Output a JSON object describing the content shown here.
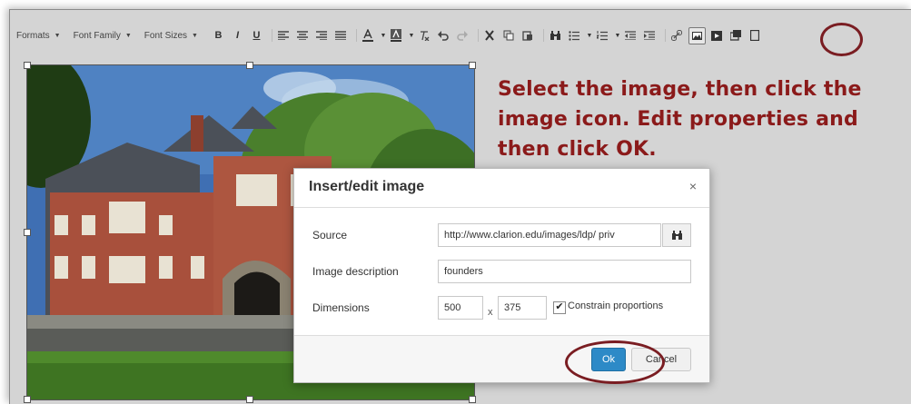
{
  "toolbar": {
    "formats_label": "Formats",
    "font_family_label": "Font Family",
    "font_sizes_label": "Font Sizes",
    "bold_label": "B",
    "italic_label": "I",
    "underline_label": "U"
  },
  "instruction": {
    "text": "Select the image, then click the image icon. Edit properties and then click OK."
  },
  "dialog": {
    "title": "Insert/edit image",
    "close_label": "×",
    "source_label": "Source",
    "source_value": "http://www.clarion.edu/images/ldp/ priv",
    "image_description_label": "Image description",
    "image_description_value": "founders",
    "dimensions_label": "Dimensions",
    "width_value": "500",
    "dimension_separator": "x",
    "height_value": "375",
    "constrain_label": "Constrain proportions",
    "constrain_checked": true,
    "ok_label": "Ok",
    "cancel_label": "Cancel"
  },
  "colors": {
    "annotation": "#7a1d22",
    "instruction_text": "#8b1a1a",
    "ok_button": "#2d8ac7"
  },
  "icons": [
    "chevron-down-icon",
    "align-left-icon",
    "align-center-icon",
    "align-right-icon",
    "align-justify-icon",
    "text-color-icon",
    "background-color-icon",
    "clear-formatting-icon",
    "undo-icon",
    "redo-icon",
    "cut-icon",
    "copy-icon",
    "paste-icon",
    "find-replace-icon",
    "bullet-list-icon",
    "numbered-list-icon",
    "outdent-icon",
    "indent-icon",
    "link-icon",
    "image-icon",
    "media-icon",
    "preview-icon",
    "browse-icon",
    "close-icon"
  ]
}
